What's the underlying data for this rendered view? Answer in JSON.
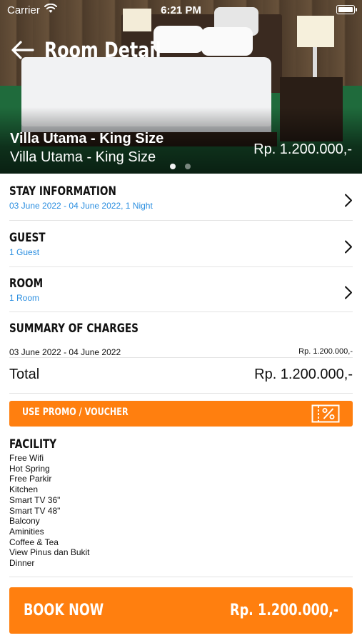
{
  "status_bar": {
    "carrier": "Carrier",
    "time": "6:21 PM"
  },
  "nav": {
    "title": "Room Detail",
    "back_icon": "arrow-left-icon"
  },
  "hero": {
    "room_name": "Villa Utama - King Size",
    "room_subtitle": "Villa Utama - King Size",
    "price": "Rp. 1.200.000,-",
    "slides_total": 2,
    "active_slide": 1
  },
  "stay": {
    "title": "STAY INFORMATION",
    "value": "03 June 2022 - 04 June 2022, 1 Night"
  },
  "guest": {
    "title": "GUEST",
    "value": "1 Guest"
  },
  "room": {
    "title": "ROOM",
    "value": "1 Room"
  },
  "summary": {
    "title": "SUMMARY OF CHARGES",
    "dates": "03 June 2022 - 04 June 2022",
    "amount": "Rp. 1.200.000,-"
  },
  "total": {
    "label": "Total",
    "value": "Rp. 1.200.000,-"
  },
  "promo": {
    "label": "USE PROMO / VOUCHER",
    "icon": "voucher-percent-icon"
  },
  "facility": {
    "title": "FACILITY",
    "items": [
      "Free Wifi",
      "Hot Spring",
      "Free Parkir",
      "Kitchen",
      "Smart TV 36\"",
      "Smart TV 48\"",
      "Balcony",
      "Aminities",
      "Coffee & Tea",
      "View Pinus dan Bukit",
      "Dinner"
    ]
  },
  "book": {
    "label": "BOOK NOW",
    "price": "Rp. 1.200.000,-"
  },
  "colors": {
    "accent": "#ff7f0f",
    "link_blue": "#2a8ee0",
    "divider": "#e3e3e3"
  }
}
